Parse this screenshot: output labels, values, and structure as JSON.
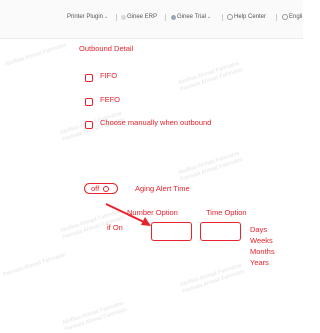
{
  "topbar": {
    "items": [
      {
        "label": "Printer Plugin",
        "has_caret": true
      },
      {
        "label": "Ginee ERP",
        "has_caret": false
      },
      {
        "label": "Ginee Trial",
        "has_caret": true
      },
      {
        "label": "Help Center",
        "has_caret": false
      },
      {
        "label": "Engli",
        "has_caret": false
      }
    ]
  },
  "outbound": {
    "title": "Outbound Detail",
    "options": [
      {
        "label": "FIFO",
        "checked": false
      },
      {
        "label": "FEFO",
        "checked": false
      },
      {
        "label": "Choose manually when outbound",
        "checked": false
      }
    ]
  },
  "aging": {
    "toggle_text": "off",
    "title": "Aging Alert Time",
    "if_on": "if On",
    "number_option": "Number Option",
    "time_option": "Time Option",
    "time_units": [
      "Days",
      "Weeks",
      "Months",
      "Years"
    ]
  },
  "watermark": {
    "line1": "Alinffiaa Ahmad Fahmalne",
    "line2": "Parmata Ahmad Fahmaldo"
  },
  "colors": {
    "accent": "#e8232c",
    "nav_text": "#555555",
    "topbar_bg": "#fafafa"
  }
}
